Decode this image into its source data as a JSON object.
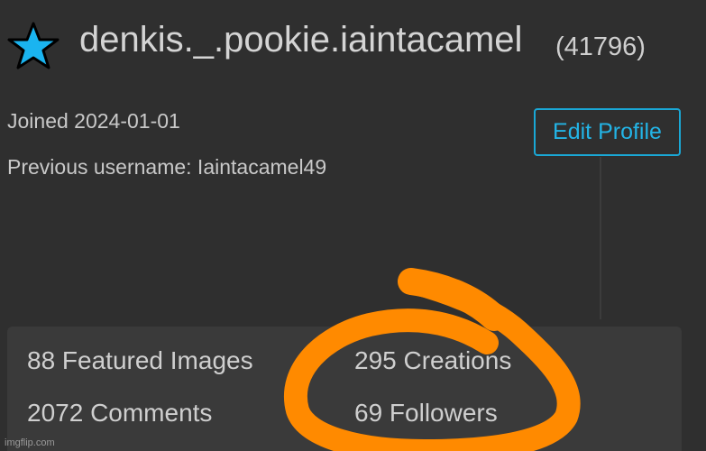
{
  "profile": {
    "username": "denkis._.pookie.iaintacamel",
    "points": "(41796)",
    "joined": "Joined 2024-01-01",
    "previous_username": "Previous username: Iaintacamel49",
    "rank_icon": "star-icon",
    "rank_color": "#1ab4f0"
  },
  "actions": {
    "edit_profile_label": "Edit Profile",
    "accent_color": "#23b4e6"
  },
  "stats": {
    "featured_images": "88 Featured Images",
    "creations": "295 Creations",
    "comments": "2072 Comments",
    "followers": "69 Followers"
  },
  "annotation": {
    "highlight_color": "#ff8a00"
  },
  "watermark": "imgflip.com"
}
